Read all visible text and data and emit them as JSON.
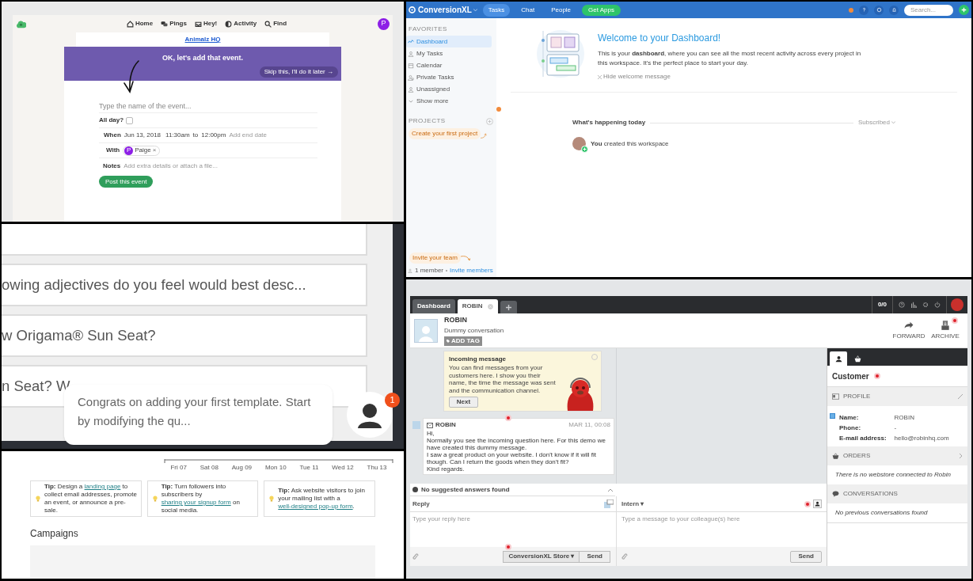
{
  "event_form": {
    "nav": [
      {
        "label": "Home"
      },
      {
        "label": "Pings"
      },
      {
        "label": "Hey!"
      },
      {
        "label": "Activity"
      },
      {
        "label": "Find"
      }
    ],
    "avatar": "P",
    "project": "Animalz HQ",
    "banner": "OK, let's add that event.",
    "skip": "Skip this, I'll do it later →",
    "name_placeholder": "Type the name of the event...",
    "all_day": {
      "label": "All day?",
      "checked": false
    },
    "when": {
      "label": "When",
      "date": "Jun 13, 2018",
      "start": "11:30am",
      "to": "to",
      "end": "12:00pm",
      "add_end": "Add end date"
    },
    "with": {
      "label": "With",
      "person": {
        "initial": "P",
        "name": "Paige",
        "remove": "×"
      }
    },
    "notes": {
      "label": "Notes",
      "placeholder": "Add extra details or attach a file..."
    },
    "post": "Post this event"
  },
  "survey": {
    "rows": [
      "owing adjectives do you feel would best desc...",
      "w Origama® Sun Seat?",
      "n Seat? W"
    ],
    "bubble": "Congrats on adding your first template. Start by modifying the qu...",
    "badge": "1"
  },
  "tips_page": {
    "timeline_labels": [
      "Fri 07",
      "Sat 08",
      "Aug 09",
      "Mon 10",
      "Tue 11",
      "Wed 12",
      "Thu 13"
    ],
    "tips": [
      {
        "label": "Tip:",
        "before": "Design a ",
        "link": "landing page",
        "after": " to collect email addresses, promote an event, or announce a pre-sale."
      },
      {
        "label": "Tip:",
        "before": "Turn followers into subscribers by ",
        "link": "sharing your signup form",
        "after": " on social media."
      },
      {
        "label": "Tip:",
        "before": "Ask website visitors to join your mailing list with a ",
        "link": "well-designed pop-up form",
        "after": "."
      }
    ],
    "heading": "Campaigns"
  },
  "dashboard": {
    "brand": "ConversionXL",
    "tabs": [
      {
        "label": "Tasks",
        "selected": true
      },
      {
        "label": "Chat",
        "selected": false
      },
      {
        "label": "People",
        "selected": false
      }
    ],
    "get_apps": "Get Apps",
    "search_placeholder": "Search...",
    "favorites_heading": "FAVORITES",
    "sidebar_items": [
      {
        "label": "Dashboard",
        "selected": true
      },
      {
        "label": "My Tasks",
        "selected": false
      },
      {
        "label": "Calendar",
        "selected": false
      },
      {
        "label": "Private Tasks",
        "selected": false
      },
      {
        "label": "Unassigned",
        "selected": false
      },
      {
        "label": "Show more",
        "selected": false
      }
    ],
    "projects_heading": "PROJECTS",
    "project_hint": "Create your first project",
    "invite_hint": "Invite your team",
    "members": "1 member",
    "invite_link": "Invite members",
    "welcome": {
      "title": "Welcome to your Dashboard!",
      "body": "This is your **dashboard**, where you can see all the most recent activity across every project in this workspace. It's the perfect place to start your day.",
      "hide": "Hide welcome message"
    },
    "feed": {
      "title": "What's happening today",
      "filter": "Subscribed",
      "items": [
        {
          "text": "**You** created this workspace"
        }
      ]
    }
  },
  "helpdesk": {
    "tabs": [
      {
        "label": "Dashboard",
        "selected": false,
        "closable": false
      },
      {
        "label": "ROBIN",
        "selected": true,
        "closable": true
      }
    ],
    "counter": "0/0",
    "contact": {
      "name": "ROBIN",
      "subtitle": "Dummy conversation",
      "tag": "ADD TAG"
    },
    "actions": [
      {
        "label": "FORWARD"
      },
      {
        "label": "ARCHIVE"
      }
    ],
    "tooltip": {
      "title": "Incoming message",
      "body": "You can find messages from your customers here. I show you their name, the time the message was sent and the communication channel.",
      "next": "Next"
    },
    "message": {
      "sender": "ROBIN",
      "time": "MAR 11, 00:08",
      "lines": [
        "Hi,",
        "Normally you see the incoming question here. For this demo we have created this dummy message.",
        "I saw a great product on your website. I don't know if it will fit though. Can I return the goods when they don't fit?",
        "Kind regards."
      ]
    },
    "suggestions": "No suggested answers found",
    "reply": {
      "label": "Reply",
      "placeholder": "Type your reply here",
      "store": "ConversionXL Store ▾",
      "send": "Send"
    },
    "intern": {
      "label": "Intern ▾",
      "placeholder": "Type a message to your colleague(s) here",
      "send": "Send"
    },
    "customer": {
      "side_tabs": [
        {
          "selected": true
        },
        {
          "selected": false
        }
      ],
      "heading": "Customer",
      "profile": "PROFILE",
      "fields": [
        {
          "label": "Name:",
          "value": "ROBIN"
        },
        {
          "label": "Phone:",
          "value": "-"
        },
        {
          "label": "E-mail address:",
          "value": "hello@robinhq.com"
        }
      ],
      "orders": "ORDERS",
      "orders_note": "There is no webstore connected to Robin",
      "conversations": "CONVERSATIONS",
      "conversations_note": "No previous conversations found"
    }
  }
}
